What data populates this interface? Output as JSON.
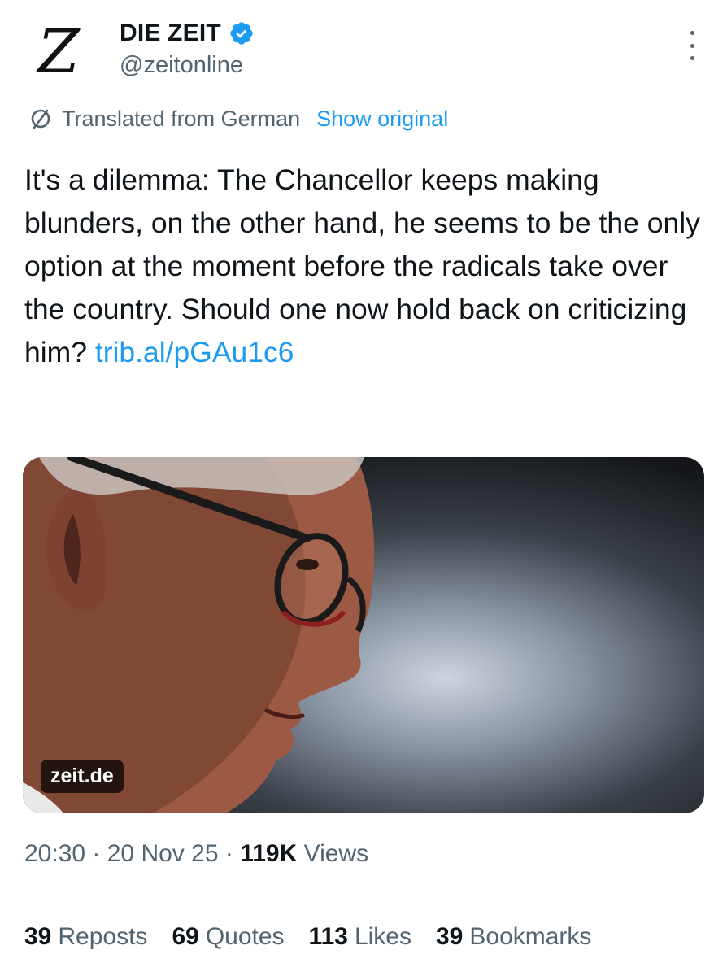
{
  "account": {
    "avatar_letter": "Z",
    "name": "DIE ZEIT",
    "handle": "@zeitonline",
    "verified": true
  },
  "translation": {
    "label": "Translated from German",
    "show_original": "Show original"
  },
  "tweet": {
    "text": "It's a dilemma: The Chancellor keeps making blunders, on the other hand, he seems to be the only option at the moment before the radicals take over the country. Should one now hold back on criticizing him?",
    "link": "trib.al/pGAu1c6"
  },
  "media": {
    "domain": "zeit.de"
  },
  "meta": {
    "time": "20:30",
    "date": "20 Nov 25",
    "views_count": "119K",
    "views_label": "Views"
  },
  "stats": [
    {
      "count": "39",
      "label": "Reposts"
    },
    {
      "count": "69",
      "label": "Quotes"
    },
    {
      "count": "113",
      "label": "Likes"
    },
    {
      "count": "39",
      "label": "Bookmarks"
    }
  ],
  "colors": {
    "link": "#1d9bf0",
    "secondary_text": "#536471",
    "primary_text": "#0f1419"
  },
  "icons": [
    "verified-badge-icon",
    "translate-icon",
    "more-options-icon"
  ]
}
